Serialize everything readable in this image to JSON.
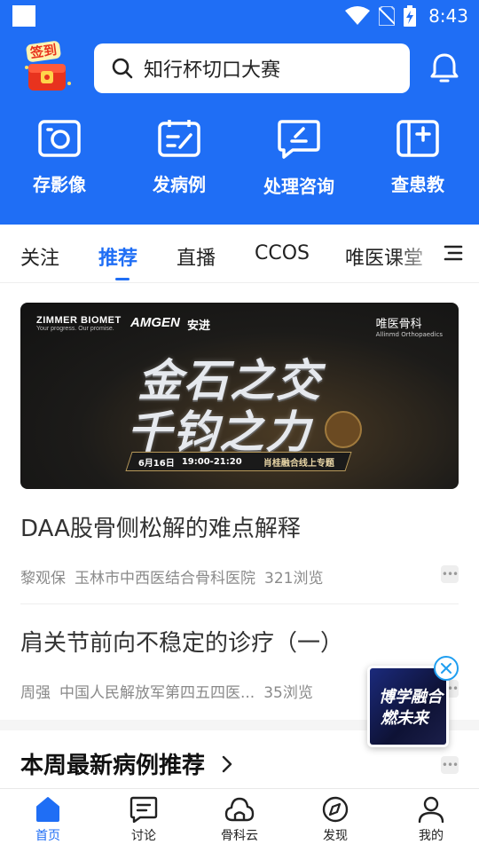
{
  "status_bar": {
    "time": "8:43",
    "icons": [
      "wifi-icon",
      "no-sim-icon",
      "battery-charging-icon"
    ]
  },
  "header": {
    "signin_label": "签到",
    "search_placeholder": "知行杯切口大赛",
    "quick_actions": [
      {
        "label": "存影像",
        "icon": "camera-icon"
      },
      {
        "label": "发病例",
        "icon": "edit-case-icon"
      },
      {
        "label": "处理咨询",
        "icon": "chat-icon"
      },
      {
        "label": "查患教",
        "icon": "patient-education-icon"
      }
    ]
  },
  "tabs": {
    "items": [
      "关注",
      "推荐",
      "直播",
      "CCOS",
      "唯医课堂"
    ],
    "active": "推荐"
  },
  "banner": {
    "sponsor_1": "ZIMMER BIOMET",
    "sponsor_1_tagline": "Your progress. Our promise.",
    "sponsor_2": "AMGEN",
    "sponsor_3": "安进",
    "brand": "唯医骨科",
    "brand_sub": "Allinmd Orthopaedics",
    "title_line_1": "金石之交",
    "title_line_2": "千钧之力",
    "date": "6月16日",
    "time": "19:00-21:20",
    "topic": "肖桂融合线上专题"
  },
  "articles": [
    {
      "title": "DAA股骨侧松解的难点解释",
      "author": "黎观保",
      "hospital": "玉林市中西医结合骨科医院",
      "views": "321浏览"
    },
    {
      "title": "肩关节前向不稳定的诊疗（一）",
      "author": "周强",
      "hospital": "中国人民解放军第四五四医...",
      "views": "35浏览"
    }
  ],
  "section": {
    "title": "本周最新病例推荐"
  },
  "float_ad": {
    "line_1": "博学融合",
    "line_2": "燃未来"
  },
  "bottom_nav": {
    "items": [
      {
        "label": "首页",
        "icon": "home-icon"
      },
      {
        "label": "讨论",
        "icon": "discussion-icon"
      },
      {
        "label": "骨科云",
        "icon": "cloud-icon"
      },
      {
        "label": "发现",
        "icon": "compass-icon"
      },
      {
        "label": "我的",
        "icon": "user-icon"
      }
    ],
    "active": "首页"
  },
  "colors": {
    "primary": "#1f6ef5",
    "text": "#333333",
    "meta": "#8a8a8a"
  }
}
